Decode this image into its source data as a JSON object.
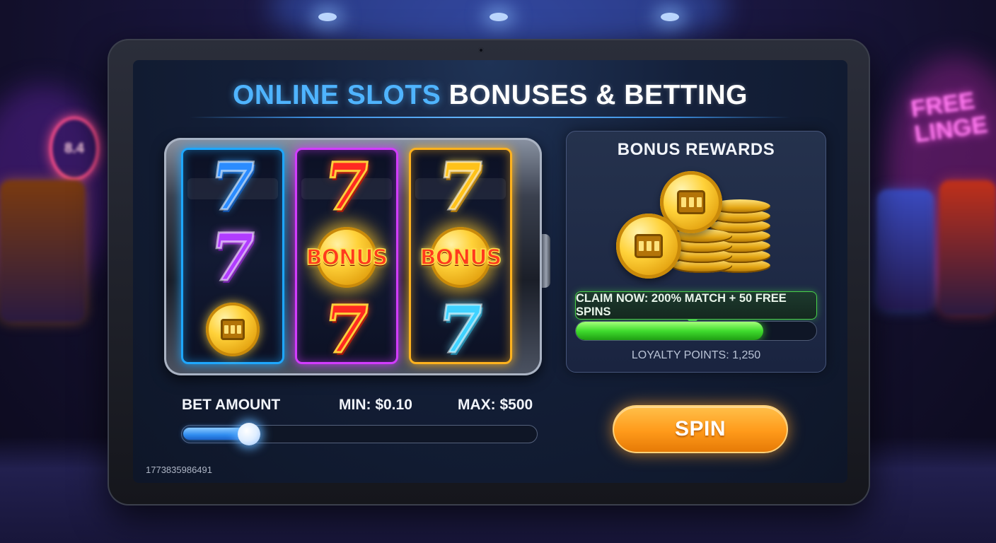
{
  "background": {
    "left_sign_text": "8.4",
    "right_sign_lines": [
      "FREE",
      "LINGE"
    ]
  },
  "header": {
    "title_part1": "ONLINE SLOTS",
    "title_part2": "BONUSES & BETTING"
  },
  "slot_machine": {
    "reels": [
      {
        "name": "reel-1",
        "frame_color": "#1ea7ff",
        "symbols": [
          "blue-seven",
          "purple-seven",
          "gold-coin"
        ]
      },
      {
        "name": "reel-2",
        "frame_color": "#d23cff",
        "symbols": [
          "red-seven",
          "bonus-coin",
          "red-seven"
        ]
      },
      {
        "name": "reel-3",
        "frame_color": "#ffb21e",
        "symbols": [
          "gold-seven",
          "bonus-coin",
          "cyan-seven"
        ]
      }
    ],
    "seven_glyph": "7",
    "bonus_label": "BONUS"
  },
  "bonus_panel": {
    "title": "BONUS REWARDS",
    "claim_label": "CLAIM NOW: 200% MATCH + 50 FREE SPINS",
    "progress_fraction": 0.78,
    "loyalty_text": "LOYALTY POINTS: 1,250"
  },
  "bet": {
    "label": "BET AMOUNT",
    "min_label": "MIN: $0.10",
    "max_label": "MAX: $500",
    "slider_fraction": 0.19
  },
  "spin_label": "SPIN",
  "serial": "1773835986491",
  "colors": {
    "title_accent": "#4fb4ff",
    "spin": "#ff9a1a",
    "progress": "#3fdc2e"
  }
}
